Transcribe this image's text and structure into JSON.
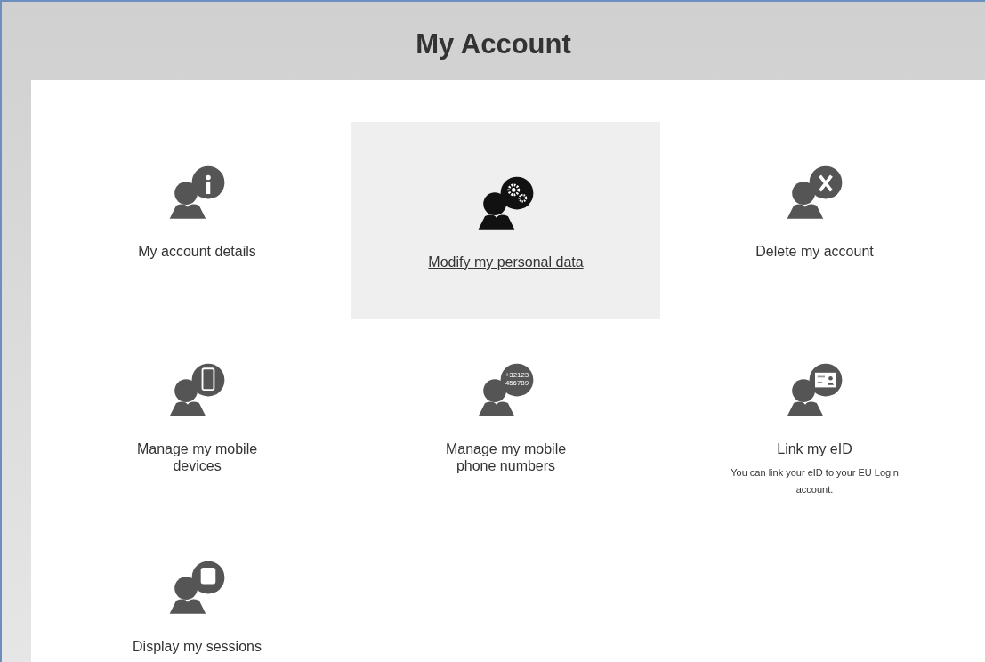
{
  "page": {
    "title": "My Account"
  },
  "tiles": [
    {
      "kind": "info",
      "label": "My account details",
      "selected": false
    },
    {
      "kind": "gears",
      "label": "Modify my personal data",
      "selected": true
    },
    {
      "kind": "delete",
      "label": "Delete my account",
      "selected": false
    },
    {
      "kind": "phone",
      "label": "Manage my mobile devices",
      "selected": false
    },
    {
      "kind": "numbers",
      "label": "Manage my mobile phone numbers",
      "icon_text": [
        "+32123",
        "456789"
      ],
      "selected": false
    },
    {
      "kind": "card",
      "label": "Link my eID",
      "description": "You can link your eID to your EU Login account.",
      "selected": false
    },
    {
      "kind": "square",
      "label": "Display my sessions",
      "selected": false
    }
  ]
}
